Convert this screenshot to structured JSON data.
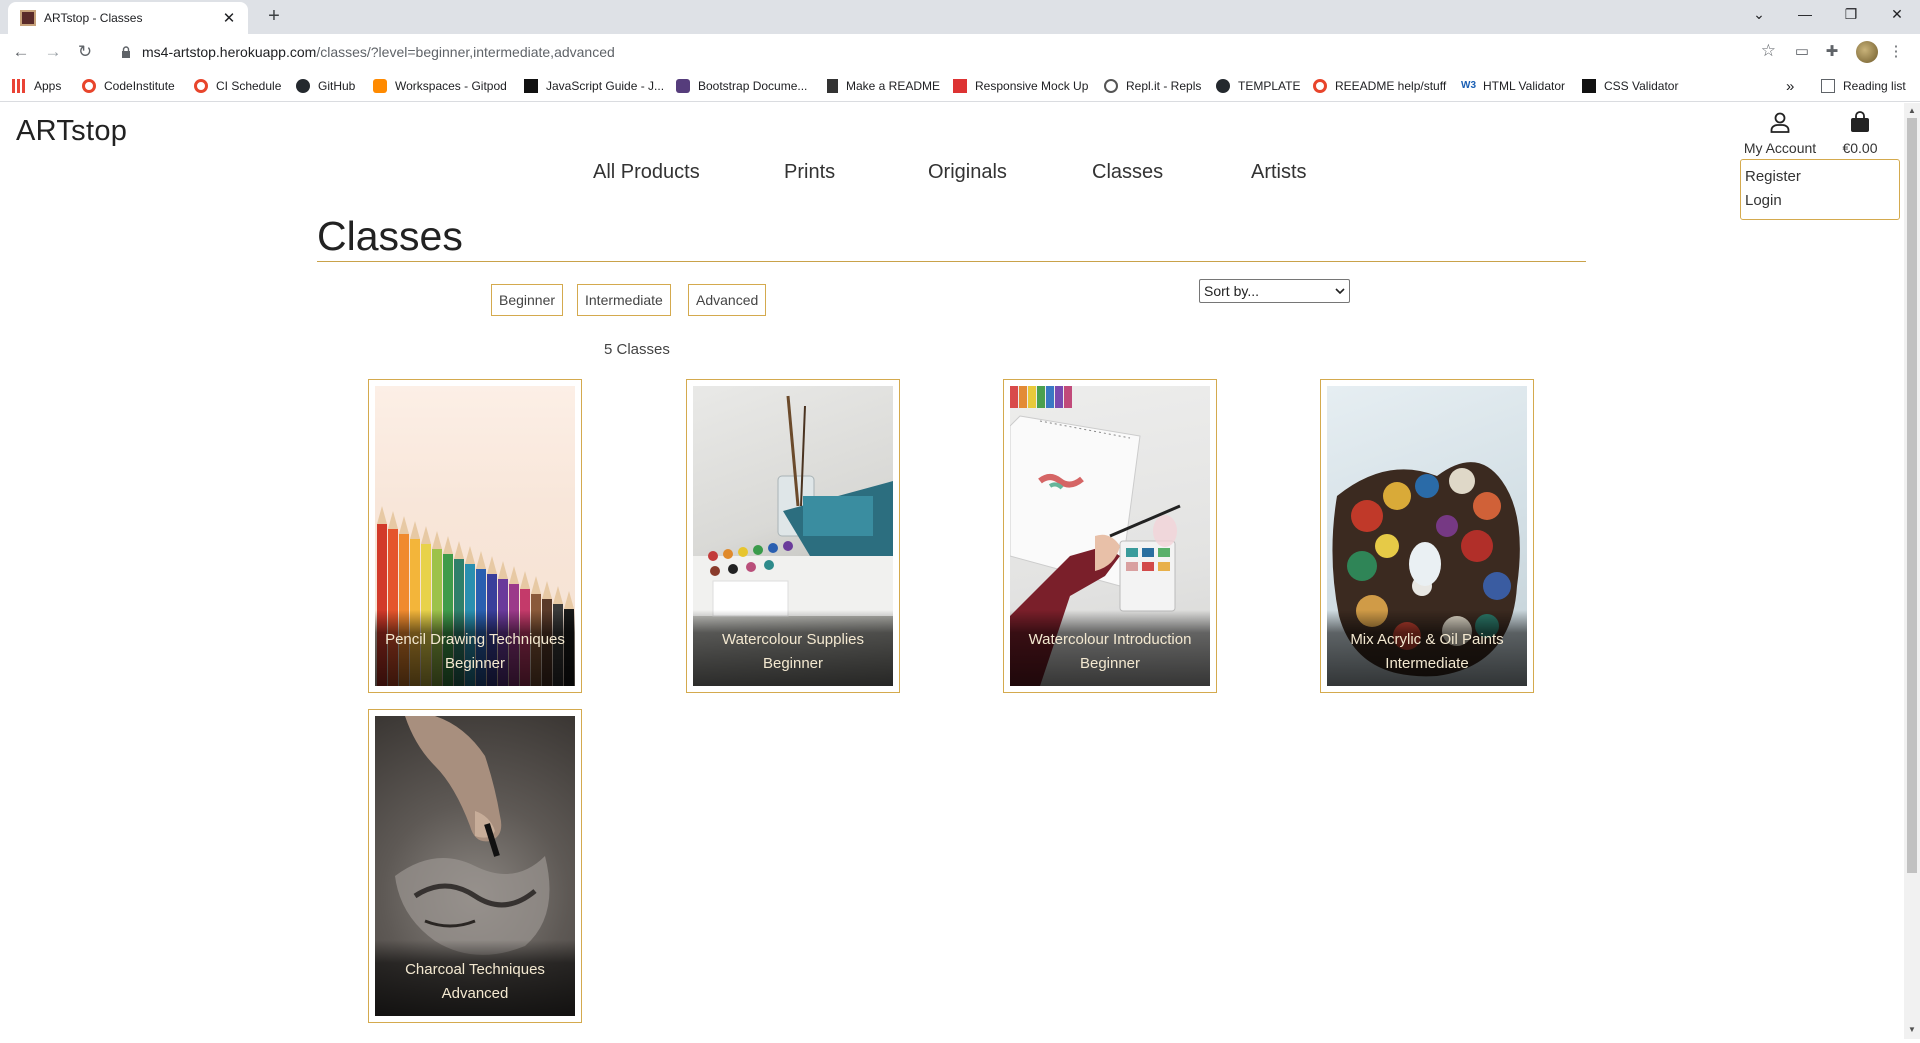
{
  "browser": {
    "tab_title": "ARTstop - Classes",
    "url_host": "ms4-artstop.herokuapp.com",
    "url_path": "/classes/?level=beginner,intermediate,advanced",
    "bookmarks": [
      "Apps",
      "CodeInstitute",
      "CI Schedule",
      "GitHub",
      "Workspaces - Gitpod",
      "JavaScript Guide - J...",
      "Bootstrap Docume...",
      "Make a README",
      "Responsive Mock Up",
      "Repl.it - Repls",
      "TEMPLATE",
      "REEADME help/stuff",
      "HTML Validator",
      "CSS Validator"
    ],
    "overflow": "»",
    "reading_list": "Reading list"
  },
  "site": {
    "brand": "ARTstop",
    "account_label": "My Account",
    "bag_total": "€0.00",
    "account_menu": [
      "Register",
      "Login"
    ],
    "nav": [
      "All Products",
      "Prints",
      "Originals",
      "Classes",
      "Artists"
    ]
  },
  "page": {
    "title": "Classes",
    "filters": [
      "Beginner",
      "Intermediate",
      "Advanced"
    ],
    "sort_placeholder": "Sort by...",
    "count_label": "5 Classes"
  },
  "classes": [
    {
      "name": "Pencil Drawing Techniques",
      "level": "Beginner",
      "image": "colored-pencils"
    },
    {
      "name": "Watercolour Supplies",
      "level": "Beginner",
      "image": "watercolour-palette"
    },
    {
      "name": "Watercolour Introduction",
      "level": "Beginner",
      "image": "hand-painting"
    },
    {
      "name": "Mix Acrylic & Oil Paints",
      "level": "Intermediate",
      "image": "paint-palette"
    },
    {
      "name": "Charcoal Techniques",
      "level": "Advanced",
      "image": "charcoal-drawing"
    }
  ],
  "colors": {
    "accent": "#d4aa4e",
    "text": "#333333",
    "caption": "#f3e8d0"
  }
}
